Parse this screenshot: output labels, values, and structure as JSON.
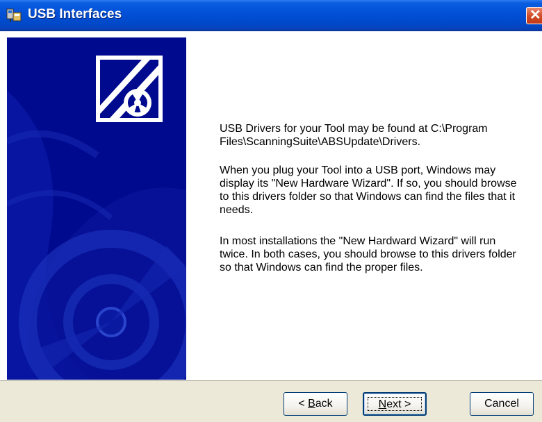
{
  "window": {
    "title": "USB Interfaces"
  },
  "icons": {
    "app": "usb-app-icon",
    "close": "close-icon",
    "logo": "scanning-suite-logo-icon"
  },
  "content": {
    "paragraphs": [
      "USB Drivers for your Tool may be found at C:\\Program Files\\ScanningSuite\\ABSUpdate\\Drivers.",
      "When you plug your Tool into a USB port, Windows may display its \"New Hardware Wizard\".  If so, you should browse to this drivers folder so that Windows can find the files that it needs.",
      "In most installations the \"New Hardward Wizard\" will run twice.  In both cases, you should browse to this drivers folder so that Windows can find the proper files."
    ]
  },
  "buttons": {
    "back_prefix": "< ",
    "back_accel": "B",
    "back_rest": "ack",
    "next_accel": "N",
    "next_rest": "ext >",
    "cancel": "Cancel"
  },
  "colors": {
    "titlebar": "#0150d6",
    "side_panel": "#000a8e",
    "dialog_bg": "#ece9d8"
  }
}
